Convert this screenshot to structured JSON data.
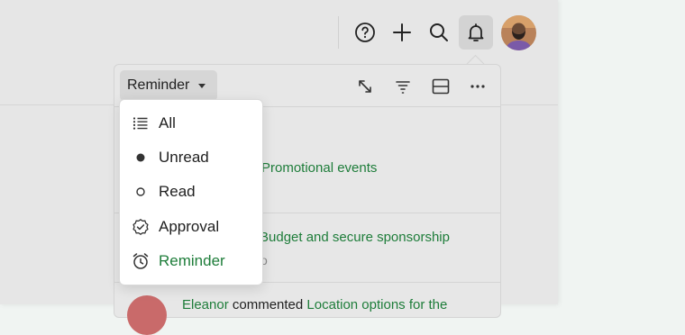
{
  "topbar": {
    "icons": [
      "help-icon",
      "plus-icon",
      "search-icon",
      "bell-icon"
    ],
    "avatar": "user-avatar"
  },
  "panel": {
    "filter_label": "Reminder",
    "header_icons": [
      "expand-icon",
      "filter-icon",
      "layout-icon",
      "more-icon"
    ],
    "notifications": [
      {
        "link": "Promotional events",
        "meta": ""
      },
      {
        "link": "Budget and secure sponsorship",
        "meta": "o"
      },
      {
        "actor": "Eleanor",
        "action": "commented",
        "link": "Location options for the"
      }
    ]
  },
  "dropdown": {
    "items": [
      {
        "label": "All",
        "icon": "list-icon"
      },
      {
        "label": "Unread",
        "icon": "filled-dot-icon"
      },
      {
        "label": "Read",
        "icon": "hollow-dot-icon"
      },
      {
        "label": "Approval",
        "icon": "check-badge-icon"
      },
      {
        "label": "Reminder",
        "icon": "alarm-clock-icon",
        "selected": true
      }
    ]
  },
  "colors": {
    "accent": "#1e7d3a",
    "app_bg": "#e6e6e6",
    "dropdown_bg": "#ffffff"
  }
}
